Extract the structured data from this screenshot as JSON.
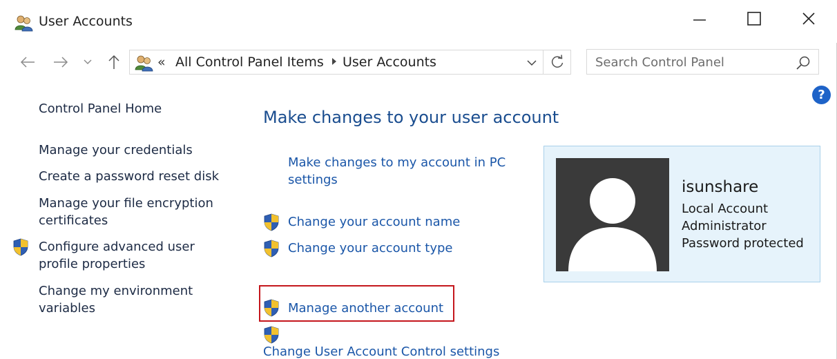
{
  "window": {
    "title": "User Accounts",
    "controls": {
      "minimize": "minimize",
      "maximize": "maximize",
      "close": "close"
    }
  },
  "address_bar": {
    "overflow": "«",
    "breadcrumbs": [
      "All Control Panel Items",
      "User Accounts"
    ]
  },
  "search": {
    "placeholder": "Search Control Panel"
  },
  "help": {
    "label": "?"
  },
  "left_pane": {
    "links": [
      {
        "label": "Control Panel Home",
        "shield": false
      },
      {
        "label": "Manage your credentials",
        "shield": false
      },
      {
        "label": "Create a password reset disk",
        "shield": false
      },
      {
        "label": "Manage your file encryption certificates",
        "shield": false
      },
      {
        "label": "Configure advanced user profile properties",
        "shield": true
      },
      {
        "label": "Change my environment variables",
        "shield": false
      }
    ]
  },
  "main": {
    "title": "Make changes to your user account",
    "links": [
      {
        "label": "Make changes to my account in PC settings",
        "shield": false
      },
      {
        "label": "Change your account name",
        "shield": true
      },
      {
        "label": "Change your account type",
        "shield": true
      },
      {
        "label": "Manage another account",
        "shield": true,
        "highlighted": true
      },
      {
        "label": "Change User Account Control settings",
        "shield": true
      }
    ]
  },
  "account": {
    "name": "isunshare",
    "details": [
      "Local Account",
      "Administrator",
      "Password protected"
    ]
  },
  "colors": {
    "link": "#1a56a8",
    "heading": "#1a4d8f",
    "highlight_border": "#c4161c",
    "card_bg": "#e6f3fb",
    "help_bg": "#1e63c8"
  }
}
